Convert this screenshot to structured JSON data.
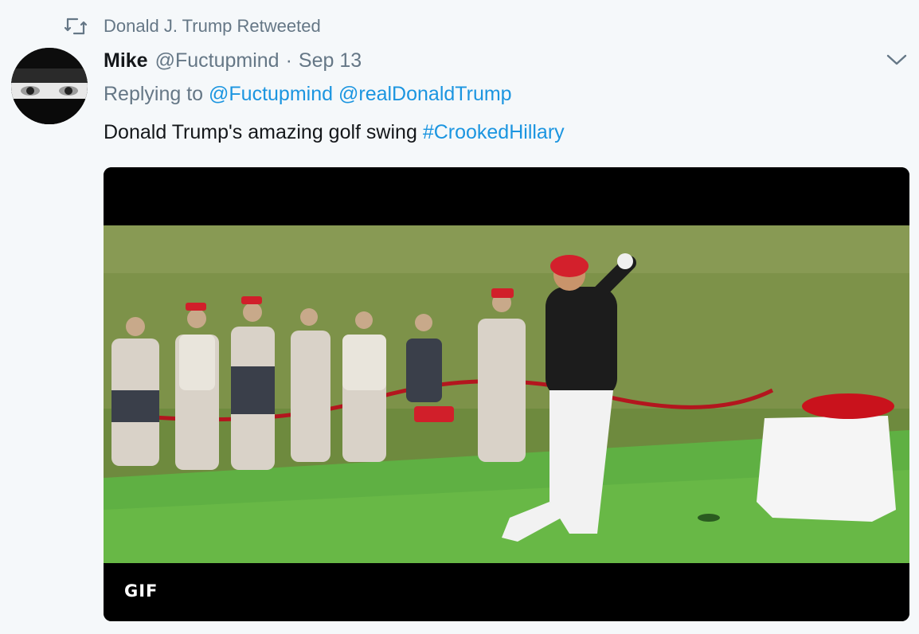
{
  "context": {
    "icon": "retweet-icon",
    "label": "Donald J. Trump Retweeted"
  },
  "tweet": {
    "name": "Mike",
    "handle": "@Fuctupmind",
    "separator": "·",
    "time": "Sep 13",
    "replying_prefix": "Replying to",
    "replying_to": [
      "@Fuctupmind",
      "@realDonaldTrump"
    ],
    "text": "Donald Trump's amazing golf swing",
    "hashtag": "#CrookedHillary"
  },
  "media": {
    "badge": "GIF"
  },
  "colors": {
    "link": "#1b95e0",
    "muted": "#657786",
    "text": "#14171a",
    "background": "#f5f8fa"
  },
  "icons": {
    "caret": "chevron-down-icon",
    "avatar": "avatar"
  }
}
